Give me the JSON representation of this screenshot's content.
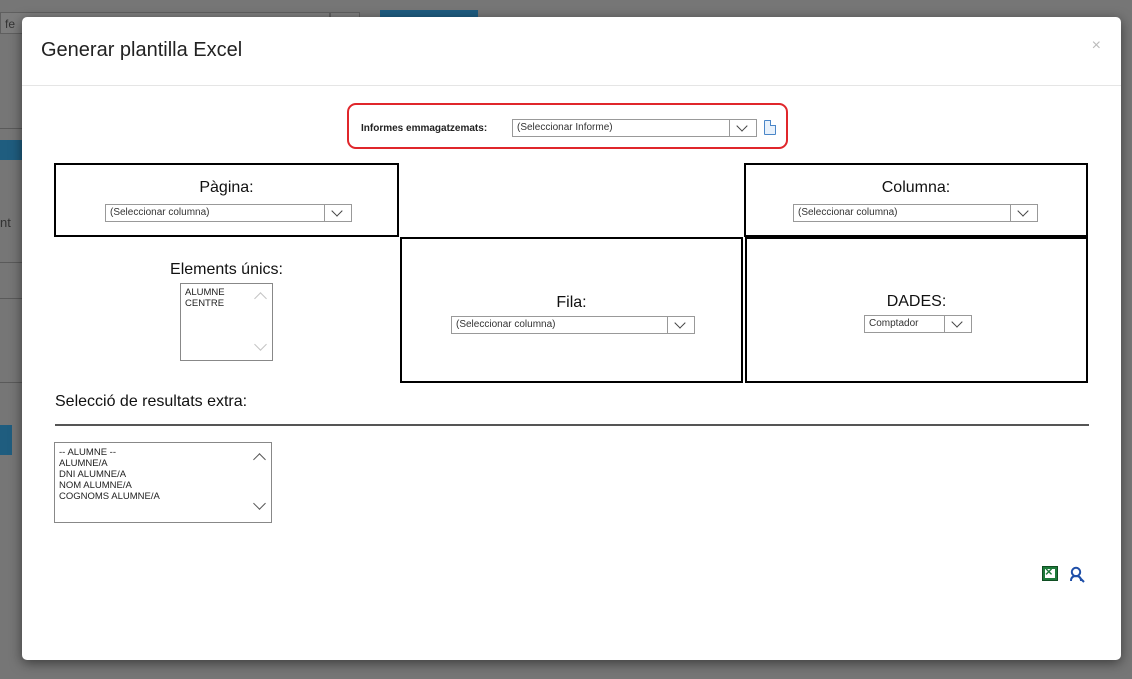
{
  "background": {
    "field_text": "fe",
    "side_text": "nt"
  },
  "modal": {
    "title": "Generar plantilla Excel",
    "close_label": "×"
  },
  "saved_reports": {
    "label": "Informes emmagatzemats:",
    "selected": "(Seleccionar Informe)"
  },
  "pagina": {
    "title": "Pàgina:",
    "selected": "(Seleccionar columna)"
  },
  "columna": {
    "title": "Columna:",
    "selected": "(Seleccionar columna)"
  },
  "elements_unics": {
    "title": "Elements únics:",
    "items": [
      "ALUMNE",
      "CENTRE"
    ]
  },
  "fila": {
    "title": "Fila:",
    "selected": "(Seleccionar columna)"
  },
  "dades": {
    "title": "DADES:",
    "selected": "Comptador"
  },
  "extra_results": {
    "title": "Selecció de resultats extra:",
    "items": [
      "-- ALUMNE --",
      "ALUMNE/A",
      "DNI ALUMNE/A",
      "NOM ALUMNE/A",
      "COGNOMS ALUMNE/A"
    ]
  },
  "icons": {
    "excel": "excel-icon",
    "user_search": "user-search-icon",
    "document": "document-icon"
  },
  "colors": {
    "highlight": "#e0262b",
    "excel_green": "#1d7a3a",
    "link_blue": "#1f4fa8"
  }
}
